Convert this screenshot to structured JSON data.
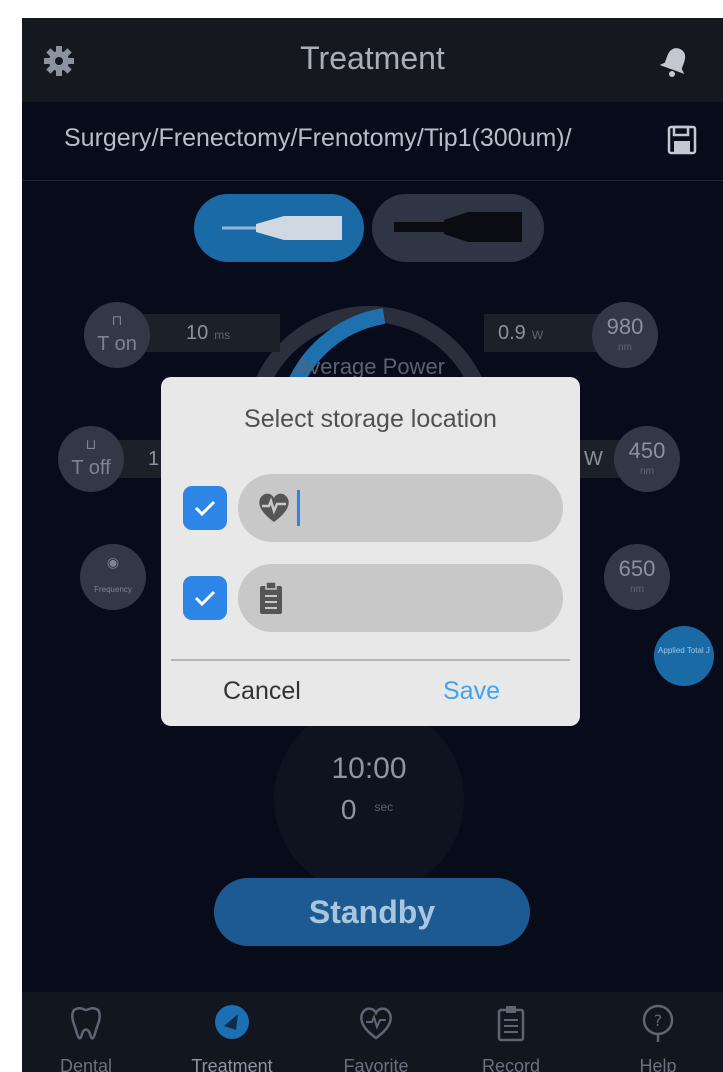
{
  "header": {
    "title": "Treatment",
    "left_icon": "gear-icon",
    "right_icon": "bell-icon"
  },
  "path_bar": {
    "path": "Surgery/Frenectomy/Frenotomy/Tip1(300um)/",
    "save_icon": "floppy-disk-icon"
  },
  "controls": {
    "t_on_label": "T on",
    "t_off_label": "T off",
    "frequency_label": "Frequency",
    "t_on_value": "10",
    "t_on_unit": "ms",
    "t_off_value": "1",
    "power_value": "0.9",
    "power_unit": "W",
    "power_unit_short": "W",
    "wavelength_1": "980",
    "wavelength_2": "450",
    "wavelength_3": "650",
    "wavelength_unit": "nm",
    "average_power_label": "Average Power"
  },
  "timer": {
    "time": "10:00",
    "seconds": "0",
    "seconds_unit": "sec"
  },
  "applied_button": "Applied Total J",
  "standby_button": "Standby",
  "bottom_nav": {
    "items": [
      {
        "label": "Dental",
        "icon": "tooth-icon"
      },
      {
        "label": "Treatment",
        "icon": "treatment-icon"
      },
      {
        "label": "Favorite",
        "icon": "heart-icon"
      },
      {
        "label": "Record",
        "icon": "clipboard-icon"
      },
      {
        "label": "Help",
        "icon": "help-icon"
      }
    ],
    "active": "Treatment"
  },
  "dialog": {
    "title": "Select storage location",
    "options": [
      {
        "icon": "heart-pulse-icon",
        "checked": true
      },
      {
        "icon": "clipboard-icon",
        "checked": true
      }
    ],
    "cancel_label": "Cancel",
    "save_label": "Save",
    "accent_color": "#2d86e6"
  }
}
